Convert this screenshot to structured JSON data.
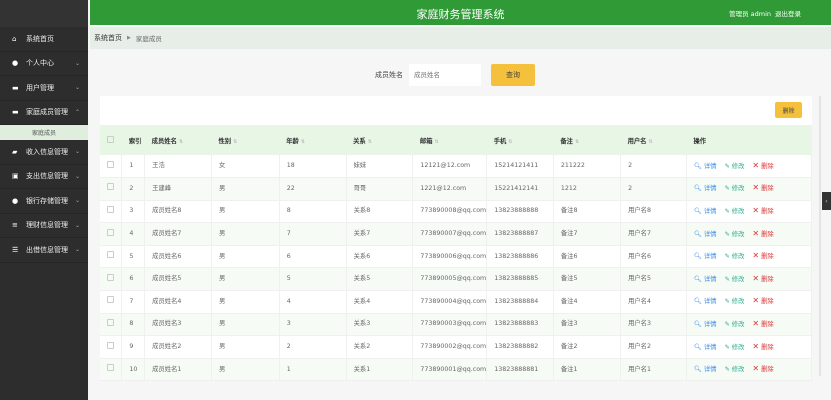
{
  "header": {
    "title": "家庭财务管理系统",
    "user": "管理员 admin",
    "logout": "退出登录"
  },
  "sidebar": {
    "items": [
      {
        "label": "系统首页",
        "icon": "home-icon",
        "chev": ""
      },
      {
        "label": "个人中心",
        "icon": "user-icon",
        "chev": "⌄"
      },
      {
        "label": "用户管理",
        "icon": "chat-icon",
        "chev": "⌄"
      },
      {
        "label": "家庭成员管理",
        "icon": "chat-icon",
        "chev": "⌃"
      },
      {
        "label": "收入信息管理",
        "icon": "wallet-icon",
        "chev": "⌄"
      },
      {
        "label": "支出信息管理",
        "icon": "doc-icon",
        "chev": "⌄"
      },
      {
        "label": "银行存储管理",
        "icon": "bulb-icon",
        "chev": "⌄"
      },
      {
        "label": "理财信息管理",
        "icon": "chart-icon",
        "chev": "⌄"
      },
      {
        "label": "出借信息管理",
        "icon": "list-icon",
        "chev": "⌄"
      }
    ],
    "sub": "家庭成员"
  },
  "breadcrumb": {
    "home": "系统首页",
    "current": "家庭成员"
  },
  "search": {
    "label": "成员姓名",
    "placeholder": "成员姓名",
    "button": "查询"
  },
  "toolbar": {
    "delete": "删除"
  },
  "table": {
    "headers": [
      "索引",
      "成员姓名",
      "性别",
      "年龄",
      "关系",
      "邮箱",
      "手机",
      "备注",
      "用户名",
      "操作"
    ],
    "actions": {
      "detail": "详情",
      "edit": "修改",
      "delete": "删除"
    },
    "rows": [
      [
        "1",
        "王浩",
        "女",
        "18",
        "妹妹",
        "12121@12.com",
        "15214121411",
        "211222",
        "2"
      ],
      [
        "2",
        "王建峰",
        "男",
        "22",
        "哥哥",
        "1221@12.com",
        "15221412141",
        "1212",
        "2"
      ],
      [
        "3",
        "成员姓名8",
        "男",
        "8",
        "关系8",
        "773890008@qq.com",
        "13823888888",
        "备注8",
        "用户名8"
      ],
      [
        "4",
        "成员姓名7",
        "男",
        "7",
        "关系7",
        "773890007@qq.com",
        "13823888887",
        "备注7",
        "用户名7"
      ],
      [
        "5",
        "成员姓名6",
        "男",
        "6",
        "关系6",
        "773890006@qq.com",
        "13823888886",
        "备注6",
        "用户名6"
      ],
      [
        "6",
        "成员姓名5",
        "男",
        "5",
        "关系5",
        "773890005@qq.com",
        "13823888885",
        "备注5",
        "用户名5"
      ],
      [
        "7",
        "成员姓名4",
        "男",
        "4",
        "关系4",
        "773890004@qq.com",
        "13823888884",
        "备注4",
        "用户名4"
      ],
      [
        "8",
        "成员姓名3",
        "男",
        "3",
        "关系3",
        "773890003@qq.com",
        "13823888883",
        "备注3",
        "用户名3"
      ],
      [
        "9",
        "成员姓名2",
        "男",
        "2",
        "关系2",
        "773890002@qq.com",
        "13823888882",
        "备注2",
        "用户名2"
      ],
      [
        "10",
        "成员姓名1",
        "男",
        "1",
        "关系1",
        "773890001@qq.com",
        "13823888881",
        "备注1",
        "用户名1"
      ]
    ]
  }
}
